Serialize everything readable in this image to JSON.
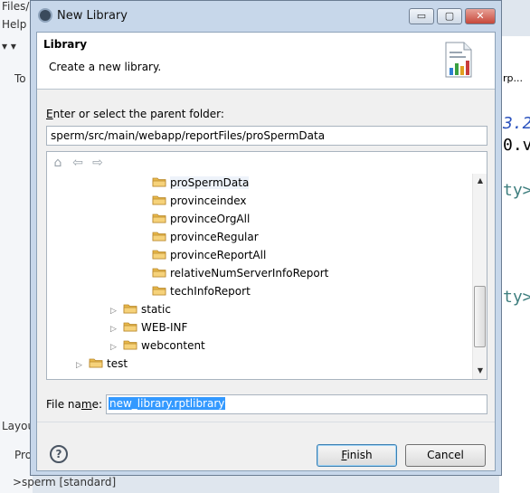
{
  "background": {
    "left_fragments": [
      "Files/p",
      "Help",
      "▾ ▾",
      "To",
      "Layou",
      "Pro",
      ">sperm [standard]"
    ],
    "right_fragments": [
      "rp...",
      "3.2",
      "0.v",
      "ty>",
      "ty>"
    ]
  },
  "dialog": {
    "title": "New Library",
    "window_buttons": {
      "minimize": "▭",
      "maximize": "▢",
      "close": "✕"
    },
    "header": {
      "title": "Library",
      "description": "Create a new library."
    },
    "parent_label": {
      "mnemonic": "E",
      "rest": "nter or select the parent folder:"
    },
    "parent_path": "sperm/src/main/webapp/reportFiles/proSpermData",
    "tree": {
      "toolbar_icons": [
        "home-icon",
        "back-arrow-icon",
        "forward-arrow-icon"
      ],
      "rows": [
        {
          "label": "proSpermData",
          "expander": ""
        },
        {
          "label": "provinceindex",
          "expander": ""
        },
        {
          "label": "provinceOrgAll",
          "expander": ""
        },
        {
          "label": "provinceRegular",
          "expander": ""
        },
        {
          "label": "provinceReportAll",
          "expander": ""
        },
        {
          "label": "relativeNumServerInfoReport",
          "expander": ""
        },
        {
          "label": "techInfoReport",
          "expander": ""
        },
        {
          "label": "static",
          "expander": "▷"
        },
        {
          "label": "WEB-INF",
          "expander": "▷"
        },
        {
          "label": "webcontent",
          "expander": "▷"
        },
        {
          "label": "test",
          "expander": "▷"
        }
      ]
    },
    "file_name_label": {
      "pre": "File na",
      "mnemonic": "m",
      "post": "e:"
    },
    "file_name_value": "new_library.rptlibrary",
    "help_symbol": "?",
    "finish": {
      "mnemonic": "F",
      "rest": "inish"
    },
    "cancel_label": "Cancel"
  },
  "colors": {
    "folder": "#e8b84a",
    "selection": "#3399ff"
  }
}
